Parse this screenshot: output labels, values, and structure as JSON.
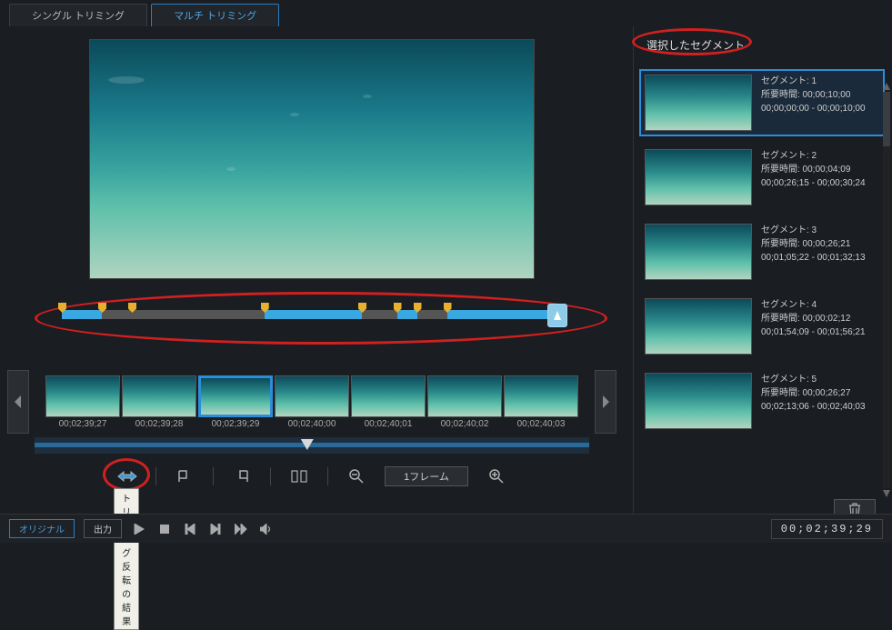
{
  "tabs": {
    "single": "シングル トリミング",
    "multi": "マルチ トリミング"
  },
  "overview": {
    "segments": [
      {
        "start_pct": 0,
        "end_pct": 8
      },
      {
        "start_pct": 40.5,
        "end_pct": 60
      },
      {
        "start_pct": 67,
        "end_pct": 71
      },
      {
        "start_pct": 77,
        "end_pct": 100
      }
    ],
    "markers_pct": [
      0,
      8,
      14,
      40.5,
      60,
      67,
      71,
      77
    ]
  },
  "frames": [
    {
      "time": "00;02;39;27"
    },
    {
      "time": "00;02;39;28"
    },
    {
      "time": "00;02;39;29",
      "selected": true
    },
    {
      "time": "00;02;40;00"
    },
    {
      "time": "00;02;40;01"
    },
    {
      "time": "00;02;40;02"
    },
    {
      "time": "00;02;40;03"
    }
  ],
  "tools": {
    "frame_step": "1フレーム",
    "tooltip": "トリミング反転の結果"
  },
  "bottom": {
    "original": "オリジナル",
    "output": "出力",
    "timecode": "00;02;39;29"
  },
  "right_panel": {
    "header": "選択したセグメント",
    "segments": [
      {
        "name": "セグメント: 1",
        "dur_label": "所要時間:",
        "dur": "00;00;10;00",
        "range": "00;00;00;00 - 00;00;10;00",
        "selected": true
      },
      {
        "name": "セグメント: 2",
        "dur_label": "所要時間:",
        "dur": "00;00;04;09",
        "range": "00;00;26;15 - 00;00;30;24"
      },
      {
        "name": "セグメント: 3",
        "dur_label": "所要時間:",
        "dur": "00;00;26;21",
        "range": "00;01;05;22 - 00;01;32;13"
      },
      {
        "name": "セグメント: 4",
        "dur_label": "所要時間:",
        "dur": "00;00;02;12",
        "range": "00;01;54;09 - 00;01;56;21"
      },
      {
        "name": "セグメント: 5",
        "dur_label": "所要時間:",
        "dur": "00;00;26;27",
        "range": "00;02;13;06 - 00;02;40;03"
      }
    ]
  }
}
